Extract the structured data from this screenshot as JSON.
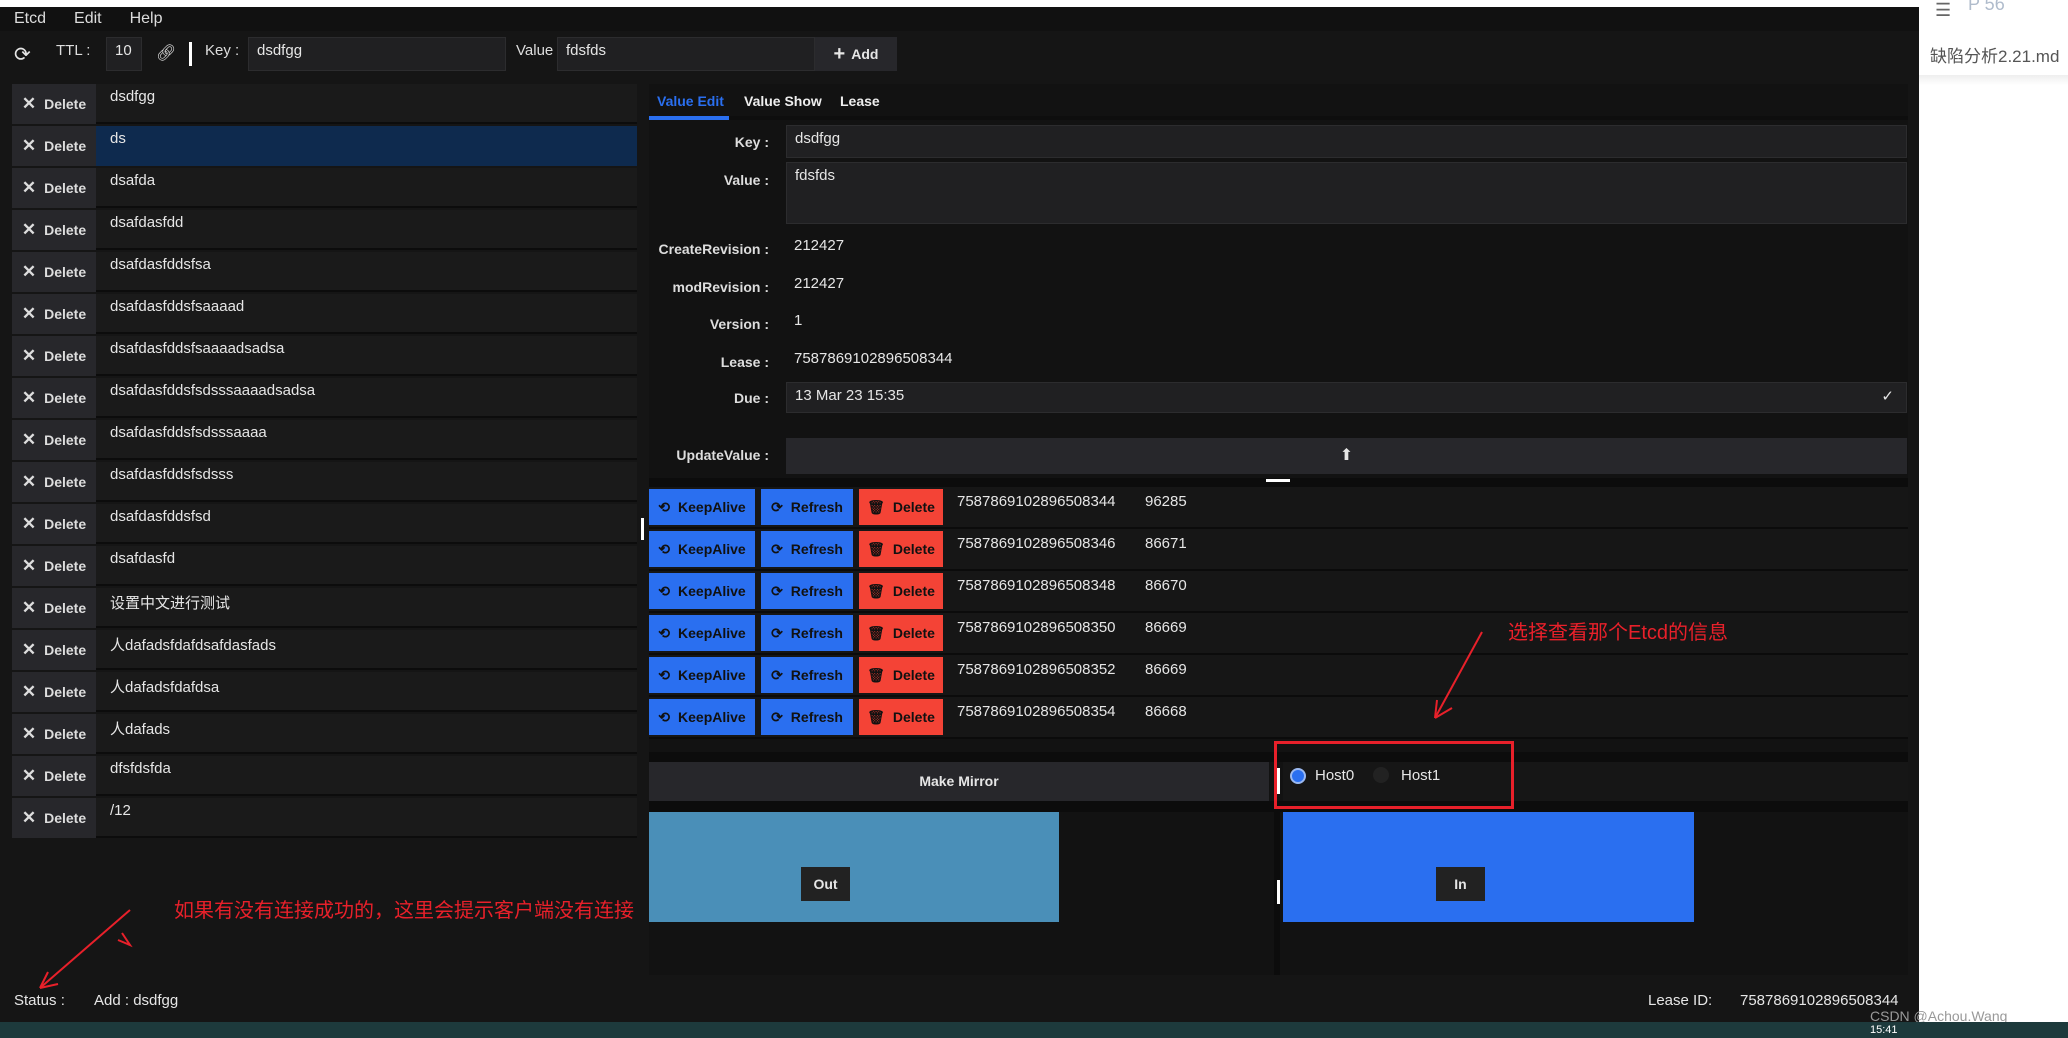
{
  "menu": [
    "Etcd",
    "Edit",
    "Help"
  ],
  "toolbar": {
    "ttl_label": "TTL :",
    "ttl_value": "10",
    "key_label": "Key :",
    "key_value": "dsdfgg",
    "value_label": "Value",
    "value_value": "fdsfds",
    "add_label": "Add"
  },
  "keys": {
    "delete_label": "Delete",
    "selected": 1,
    "items": [
      "dsdfgg",
      "ds",
      "dsafda",
      "dsafdasfdd",
      "dsafdasfddsfsa",
      "dsafdasfddsfsaaaad",
      "dsafdasfddsfsaaaadsadsa",
      "dsafdasfddsfsdsssaaaadsadsa",
      "dsafdasfddsfsdsssaaaa",
      "dsafdasfddsfsdsss",
      "dsafdasfddsfsd",
      "dsafdasfd",
      "设置中文进行测试",
      "人dafadsfdafdsafdasfads",
      "人dafadsfdafdsa",
      "人dafads",
      "dfsfdsfda",
      "/12"
    ]
  },
  "tabs": {
    "items": [
      "Value Edit",
      "Value Show",
      "Lease"
    ],
    "active": 0
  },
  "form": {
    "key_label": "Key :",
    "key": "dsdfgg",
    "value_label": "Value :",
    "value": "fdsfds",
    "create_label": "CreateRevision :",
    "create": "212427",
    "mod_label": "modRevision :",
    "mod": "212427",
    "version_label": "Version :",
    "version": "1",
    "lease_label": "Lease :",
    "lease": "7587869102896508344",
    "due_label": "Due :",
    "due": "13 Mar 23 15:35",
    "update_label": "UpdateValue :"
  },
  "leases": {
    "keepalive_label": "KeepAlive",
    "refresh_label": "Refresh",
    "delete_label": "Delete",
    "rows": [
      [
        "7587869102896508344",
        "96285"
      ],
      [
        "7587869102896508346",
        "86671"
      ],
      [
        "7587869102896508348",
        "86670"
      ],
      [
        "7587869102896508350",
        "86669"
      ],
      [
        "7587869102896508352",
        "86669"
      ],
      [
        "7587869102896508354",
        "86668"
      ]
    ]
  },
  "mirror": {
    "label": "Make Mirror",
    "hosts": [
      "Host0",
      "Host1"
    ],
    "selected": 0,
    "out_label": "Out",
    "in_label": "In"
  },
  "status": {
    "label": "Status :",
    "message": "Add : dsdfgg",
    "lease_label": "Lease ID:",
    "lease_id": "7587869102896508344"
  },
  "annotations": {
    "status_note": "如果有没有连接成功的，这里会提示客户端没有连接",
    "host_note": "选择查看那个Etcd的信息"
  },
  "side": {
    "page": "P 56",
    "file": "缺陷分析2.21.md",
    "watermark": "CSDN @Achou.Wang",
    "clock": "15:41"
  },
  "colors": {
    "accent": "#2a6ff0",
    "danger": "#f44336",
    "out_box": "#4a8fb8",
    "annotation": "#e8202a"
  }
}
